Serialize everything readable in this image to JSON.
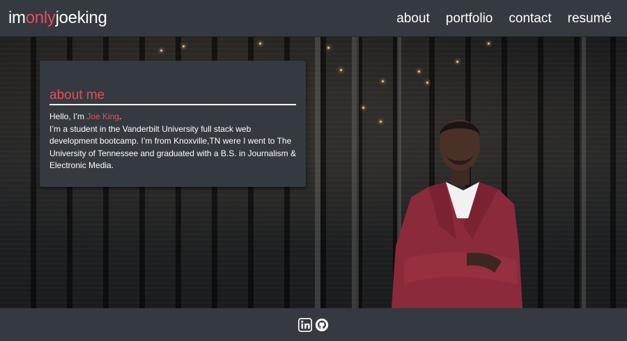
{
  "navbar": {
    "brand": {
      "part1": "im",
      "part2": "only",
      "part3": "joeking"
    },
    "links": [
      "about",
      "portfolio",
      "contact",
      "resumé"
    ]
  },
  "about": {
    "title": "about me",
    "greeting_prefix": "Hello, I’m",
    "name": "Joe King",
    "greeting_suffix": ".",
    "bio": "I’m a student in the Vanderbilt University full stack web development bootcamp. I’m from Knoxville,TN were I went to The University of Tennessee and graduated with a B.S. in Journalism & Electronic Media."
  },
  "footer": {
    "icons": [
      "linkedin-icon",
      "github-icon"
    ]
  },
  "colors": {
    "accent": "#e74c5e",
    "navbar": "#343a40",
    "text": "#ffffff"
  }
}
